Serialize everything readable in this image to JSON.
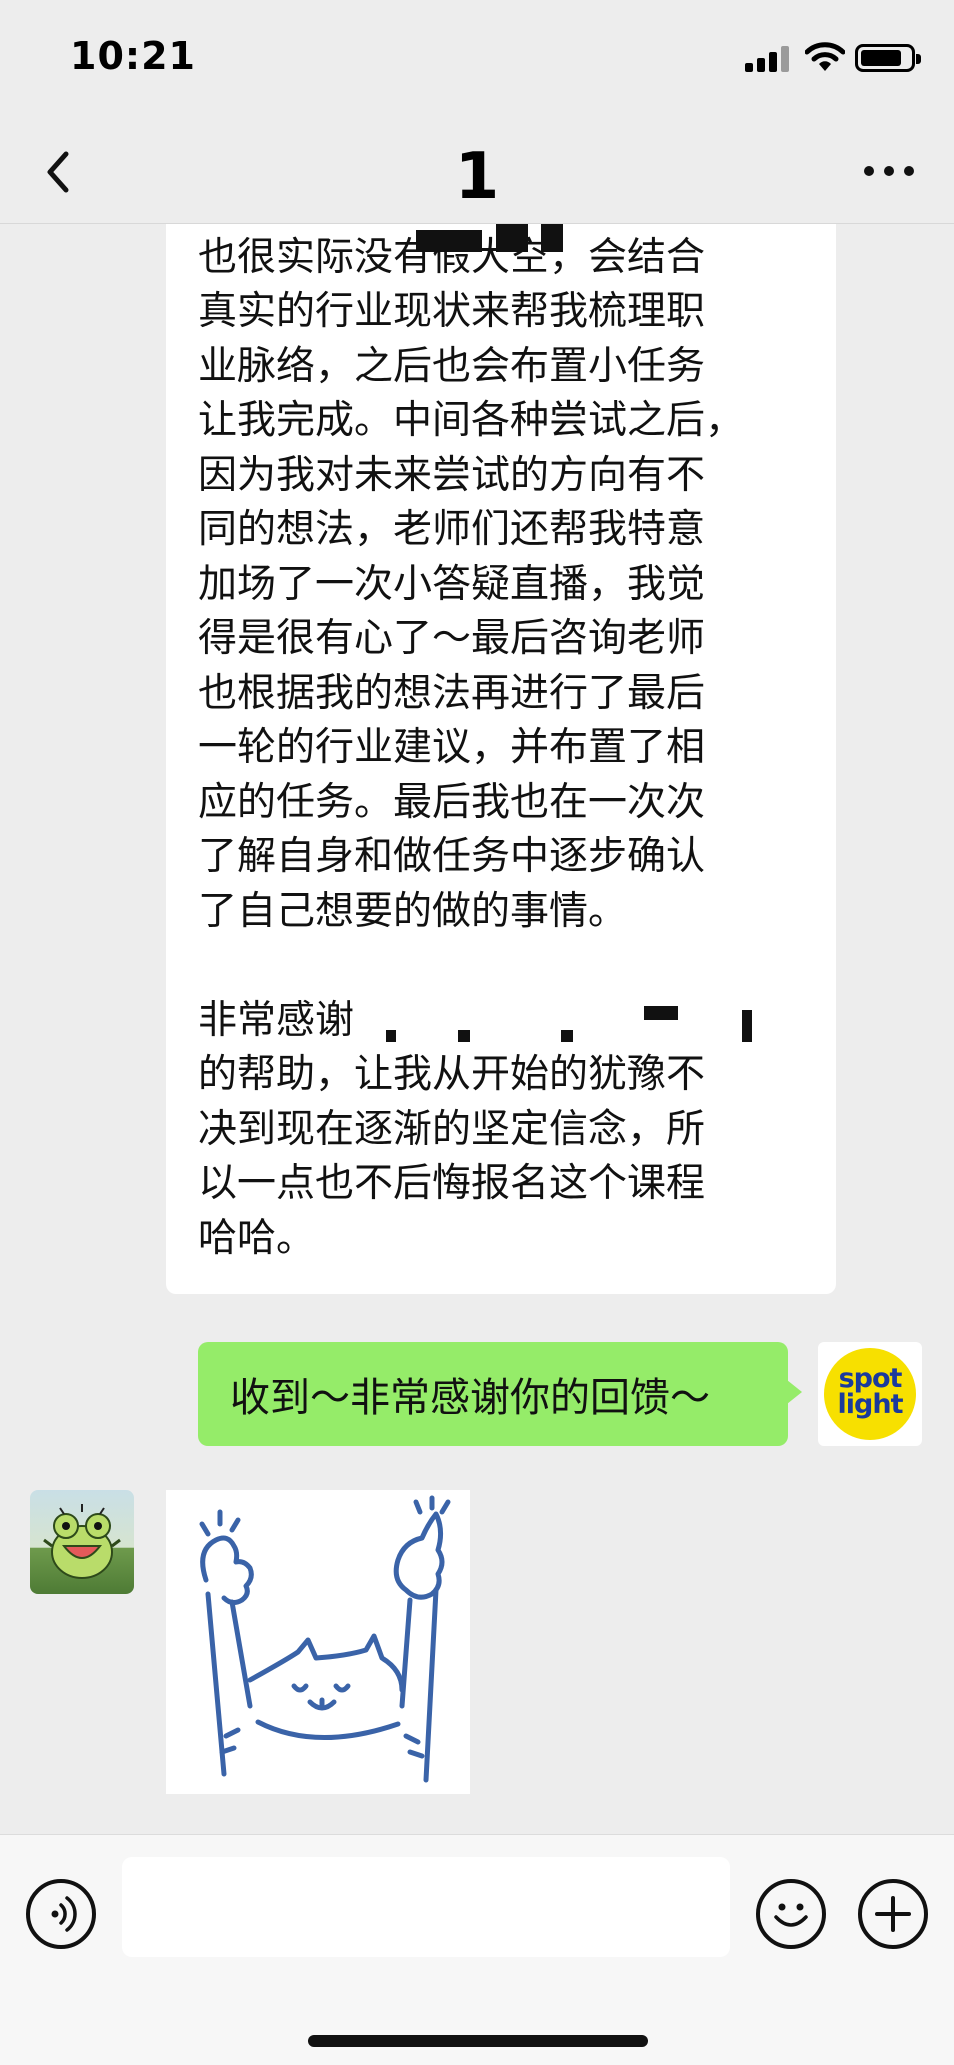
{
  "status_bar": {
    "time": "10:21"
  },
  "nav": {
    "title": "1"
  },
  "messages": {
    "incoming_text": "识的想法，                    的解说\n也很实际没有假大空，会结合\n真实的行业现状来帮我梳理职\n业脉络，之后也会布置小任务\n让我完成。中间各种尝试之后，\n因为我对未来尝试的方向有不\n同的想法，老师们还帮我特意\n加场了一次小答疑直播，我觉\n得是很有心了～最后咨询老师\n也根据我的想法再进行了最后\n一轮的行业建议，并布置了相\n应的任务。最后我也在一次次\n了解自身和做任务中逐步确认\n了自己想要的做的事情。\n\n非常感谢\n的帮助，让我从开始的犹豫不\n决到现在逐渐的坚定信念，所\n以一点也不后悔报名这个课程\n哈哈。",
    "outgoing_text": "收到～非常感谢你的回馈～",
    "outgoing_avatar_text_line1": "spot",
    "outgoing_avatar_text_line2": "light"
  },
  "icons": {
    "back": "chevron-left-icon",
    "more": "more-dots-icon",
    "voice": "voice-icon",
    "emoji": "emoji-icon",
    "plus": "plus-icon"
  },
  "colors": {
    "background": "#ededed",
    "outgoing_bubble": "#95ec69",
    "incoming_bubble": "#ffffff",
    "spotlight_yellow": "#f7e000",
    "spotlight_blue": "#1a3a9c",
    "sticker_blue": "#3a63a8"
  }
}
